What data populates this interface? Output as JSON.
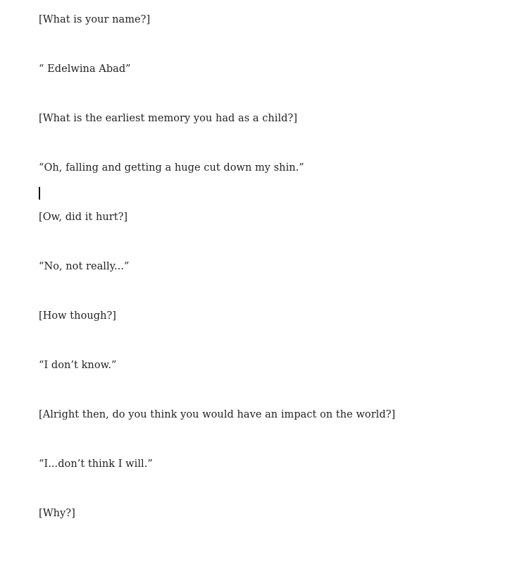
{
  "document": {
    "lines": [
      "[What is your name?]",
      "“ Edelwina Abad”",
      "[What is the earliest memory you had as a child?]",
      "“Oh, falling and getting a huge cut down my shin.”",
      "[Ow, did it hurt?]",
      "“No, not really...”",
      "[How though?]",
      "“I don’t know.”",
      "[Alright then, do you think you would have an impact on the world?]",
      "“I...don’t think I will.”",
      "[Why?]"
    ]
  }
}
